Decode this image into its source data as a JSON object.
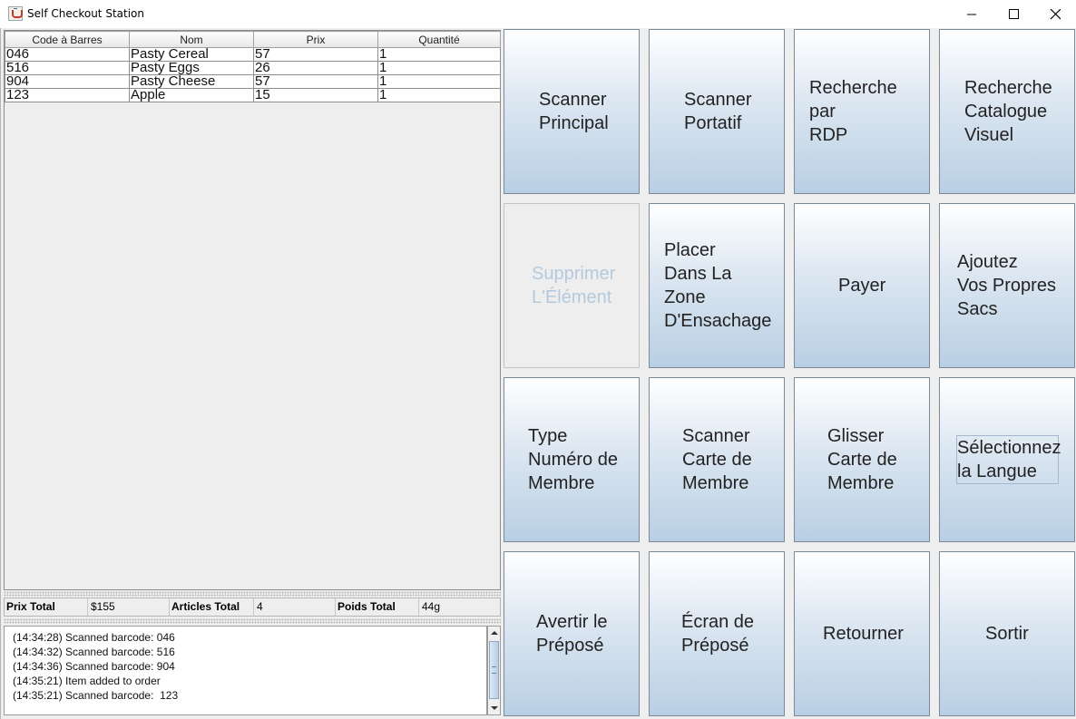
{
  "window": {
    "title": "Self Checkout Station"
  },
  "table": {
    "headers": [
      "Code à Barres",
      "Nom",
      "Prix",
      "Quantité"
    ],
    "rows": [
      [
        "046",
        "Pasty Cereal",
        "57",
        "1"
      ],
      [
        "516",
        "Pasty Eggs",
        "26",
        "1"
      ],
      [
        "904",
        "Pasty Cheese",
        "57",
        "1"
      ],
      [
        "123",
        "Apple",
        "15",
        "1"
      ]
    ]
  },
  "totals": {
    "price_label": "Prix Total",
    "price_value": "$155",
    "items_label": "Articles Total",
    "items_value": "4",
    "weight_label": "Poids Total",
    "weight_value": "44g"
  },
  "log": [
    "(14:34:28) Scanned barcode: 046",
    "(14:34:32) Scanned barcode: 516",
    "(14:34:36) Scanned barcode: 904",
    "(14:35:21) Item added to order",
    "(14:35:21) Scanned barcode:  123"
  ],
  "buttons": {
    "main_scanner": "Scanner\nPrincipal",
    "handheld_scanner": "Scanner\nPortatif",
    "plu_search": "Recherche\npar\nRDP",
    "visual_catalogue": "Recherche\nCatalogue\nVisuel",
    "remove_item": "Supprimer\nL'Élément",
    "bagging_area": "Placer\nDans La\nZone\nD'Ensachage",
    "pay": "Payer",
    "own_bags": "Ajoutez\nVos Propres\nSacs",
    "type_member": "Type\nNuméro de\nMembre",
    "scan_member": "Scanner\nCarte de\nMembre",
    "swipe_member": "Glisser\nCarte de\nMembre",
    "select_language": "Sélectionnez\nla Langue",
    "notify_attendant": "Avertir le\nPréposé",
    "attendant_screen": "Écran de\nPréposé",
    "back": "Retourner",
    "exit": "Sortir"
  }
}
